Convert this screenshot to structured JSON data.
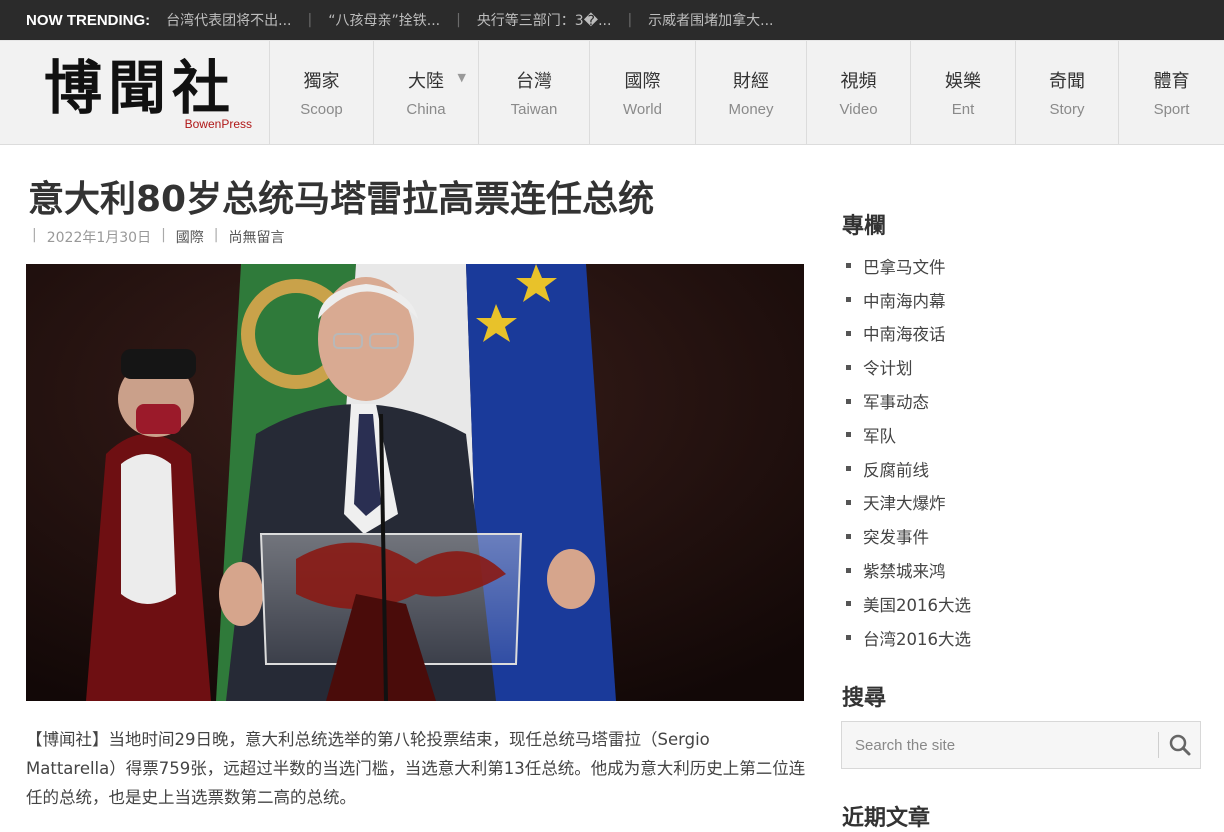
{
  "trending": {
    "label": "NOW TRENDING:",
    "items": [
      "台湾代表团将不出...",
      "“八孩母亲”拴铁...",
      "央行等三部门：3�...",
      "示威者围堵加拿大..."
    ]
  },
  "logo": {
    "cn": "博聞社",
    "en": "BowenPress"
  },
  "nav": [
    {
      "cn": "獨家",
      "en": "Scoop"
    },
    {
      "cn": "大陸",
      "en": "China"
    },
    {
      "cn": "台灣",
      "en": "Taiwan"
    },
    {
      "cn": "國際",
      "en": "World"
    },
    {
      "cn": "財經",
      "en": "Money"
    },
    {
      "cn": "視頻",
      "en": "Video"
    },
    {
      "cn": "娛樂",
      "en": "Ent"
    },
    {
      "cn": "奇聞",
      "en": "Story"
    },
    {
      "cn": "體育",
      "en": "Sport"
    }
  ],
  "article": {
    "title": "意大利80岁总统马塔雷拉高票连任总统",
    "date": "2022年1月30日",
    "category": "國際",
    "comments": "尚無留言",
    "body": "【博闻社】当地时间29日晚，意大利总统选举的第八轮投票结束，现任总统马塔雷拉（Sergio Mattarella）得票759张，远超过半数的当选门槛，当选意大利第13任总统。他成为意大利历史上第二位连任的总统，也是史上当选票数第二高的总统。"
  },
  "sidebar": {
    "columns_heading": "專欄",
    "columns": [
      "巴拿马文件",
      "中南海内幕",
      "中南海夜话",
      "令计划",
      "军事动态",
      "军队",
      "反腐前线",
      "天津大爆炸",
      "突发事件",
      "紫禁城来鸿",
      "美国2016大选",
      "台湾2016大选"
    ],
    "search_heading": "搜尋",
    "search_placeholder": "Search the site",
    "recent_heading": "近期文章"
  },
  "colors": {
    "topbar": "#2b2b2b",
    "logo_red": "#b01818",
    "header_bg": "#f2f2f2"
  }
}
